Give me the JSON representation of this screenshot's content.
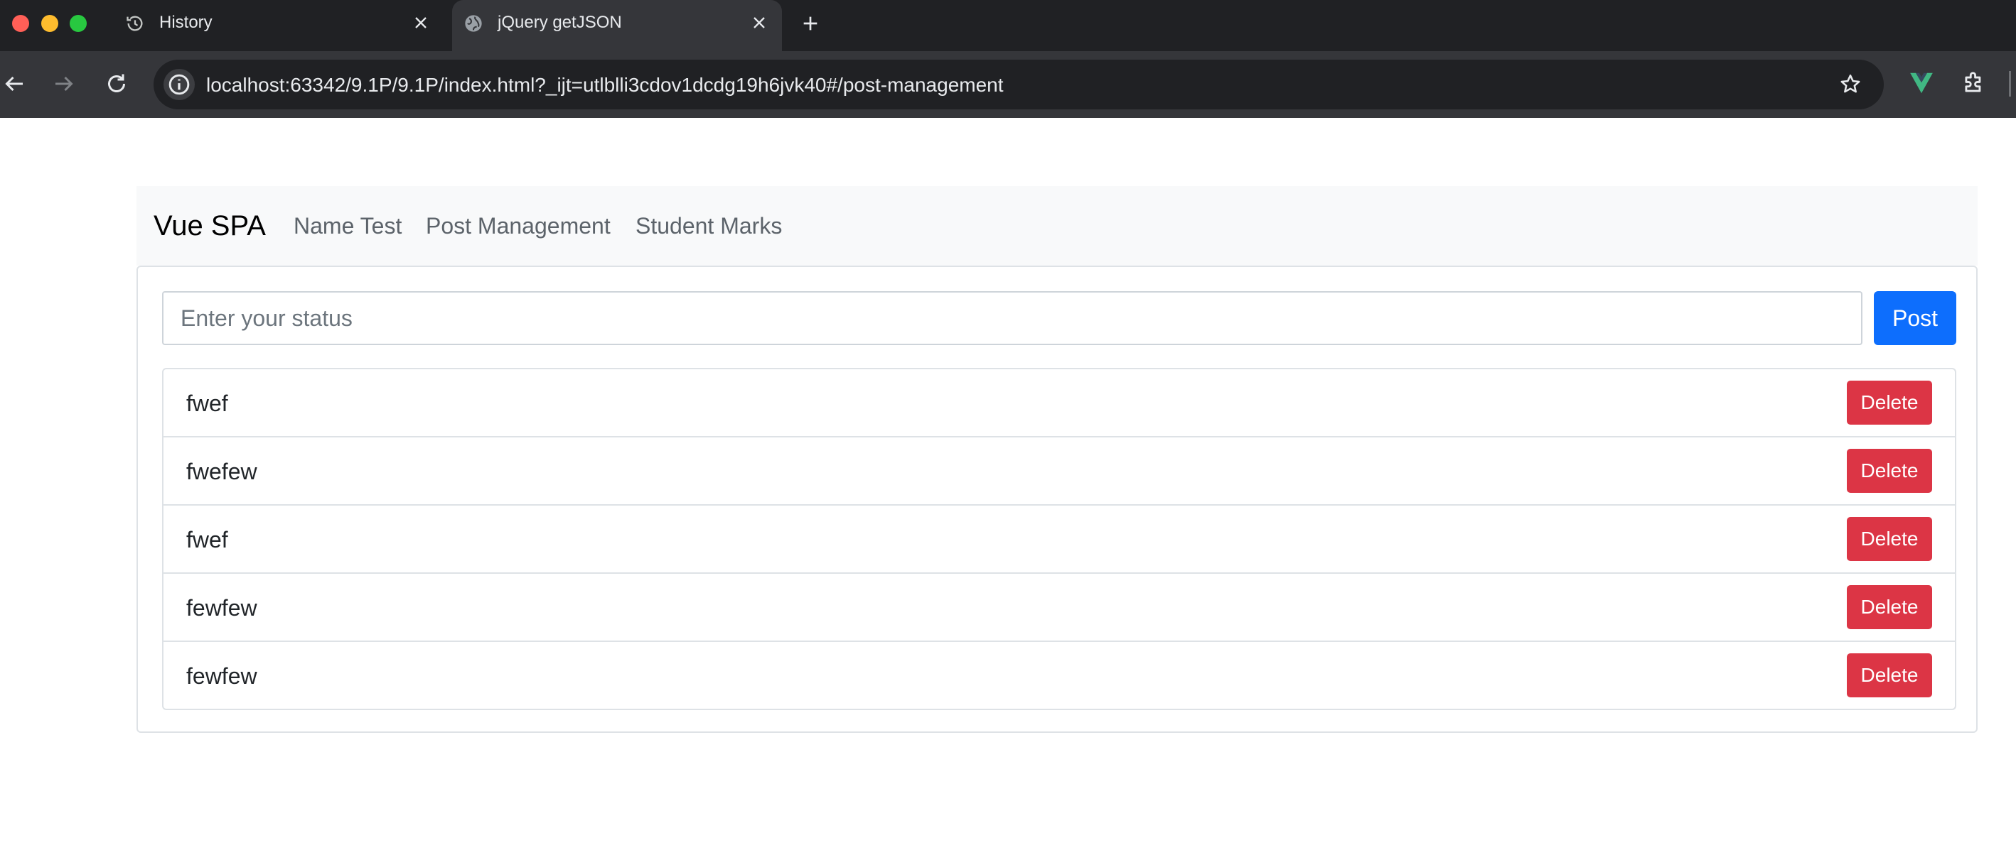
{
  "browser": {
    "tabs": [
      {
        "label": "History",
        "icon": "history-icon"
      },
      {
        "label": "jQuery getJSON",
        "icon": "globe-icon"
      }
    ],
    "url": "localhost:63342/9.1P/9.1P/index.html?_ijt=utlblli3cdov1dcdg19h6jvk40#/post-management"
  },
  "navbar": {
    "brand": "Vue SPA",
    "links": [
      "Name Test",
      "Post Management",
      "Student Marks"
    ]
  },
  "composer": {
    "placeholder": "Enter your status",
    "value": "",
    "post_label": "Post"
  },
  "posts": [
    {
      "text": "fwef",
      "delete_label": "Delete"
    },
    {
      "text": "fwefew",
      "delete_label": "Delete"
    },
    {
      "text": "fwef",
      "delete_label": "Delete"
    },
    {
      "text": "fewfew",
      "delete_label": "Delete"
    },
    {
      "text": "fewfew",
      "delete_label": "Delete"
    }
  ],
  "colors": {
    "primary": "#0d6efd",
    "danger": "#dc3545",
    "chrome_dark": "#202124",
    "chrome_toolbar": "#35363a"
  }
}
